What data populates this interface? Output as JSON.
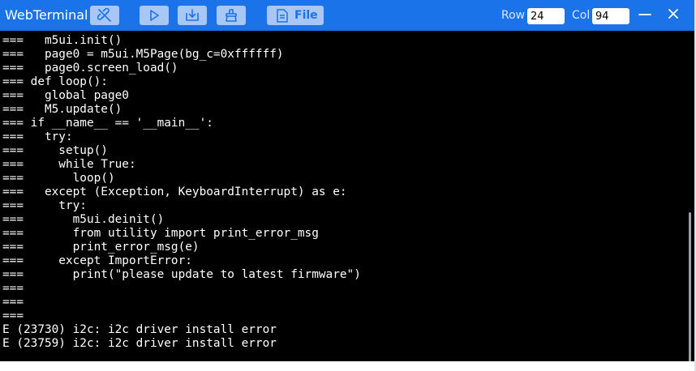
{
  "window": {
    "title": "WebTerminal"
  },
  "toolbar": {
    "file_label": "File",
    "row_label": "Row",
    "row_value": "24",
    "col_label": "Col",
    "col_value": "94",
    "icons": [
      "unlink-icon",
      "play-icon",
      "download-icon",
      "clear-icon",
      "file-icon",
      "minimize-icon",
      "close-icon"
    ]
  },
  "colors": {
    "titlebar": "#1a73e8",
    "button_bg": "#a9c7f6",
    "terminal_bg": "#000000",
    "terminal_fg": "#ffffff"
  },
  "terminal": {
    "lines": [
      "===   m5ui.init()",
      "===   page0 = m5ui.M5Page(bg_c=0xffffff)",
      "===   page0.screen_load()",
      "=== def loop():",
      "===   global page0",
      "===   M5.update()",
      "=== if __name__ == '__main__':",
      "===   try:",
      "===     setup()",
      "===     while True:",
      "===       loop()",
      "===   except (Exception, KeyboardInterrupt) as e:",
      "===     try:",
      "===       m5ui.deinit()",
      "===       from utility import print_error_msg",
      "===       print_error_msg(e)",
      "===     except ImportError:",
      "===       print(\"please update to latest firmware\")",
      "===",
      "===",
      "===",
      "E (23730) i2c: i2c driver install error",
      "E (23759) i2c: i2c driver install error"
    ]
  }
}
